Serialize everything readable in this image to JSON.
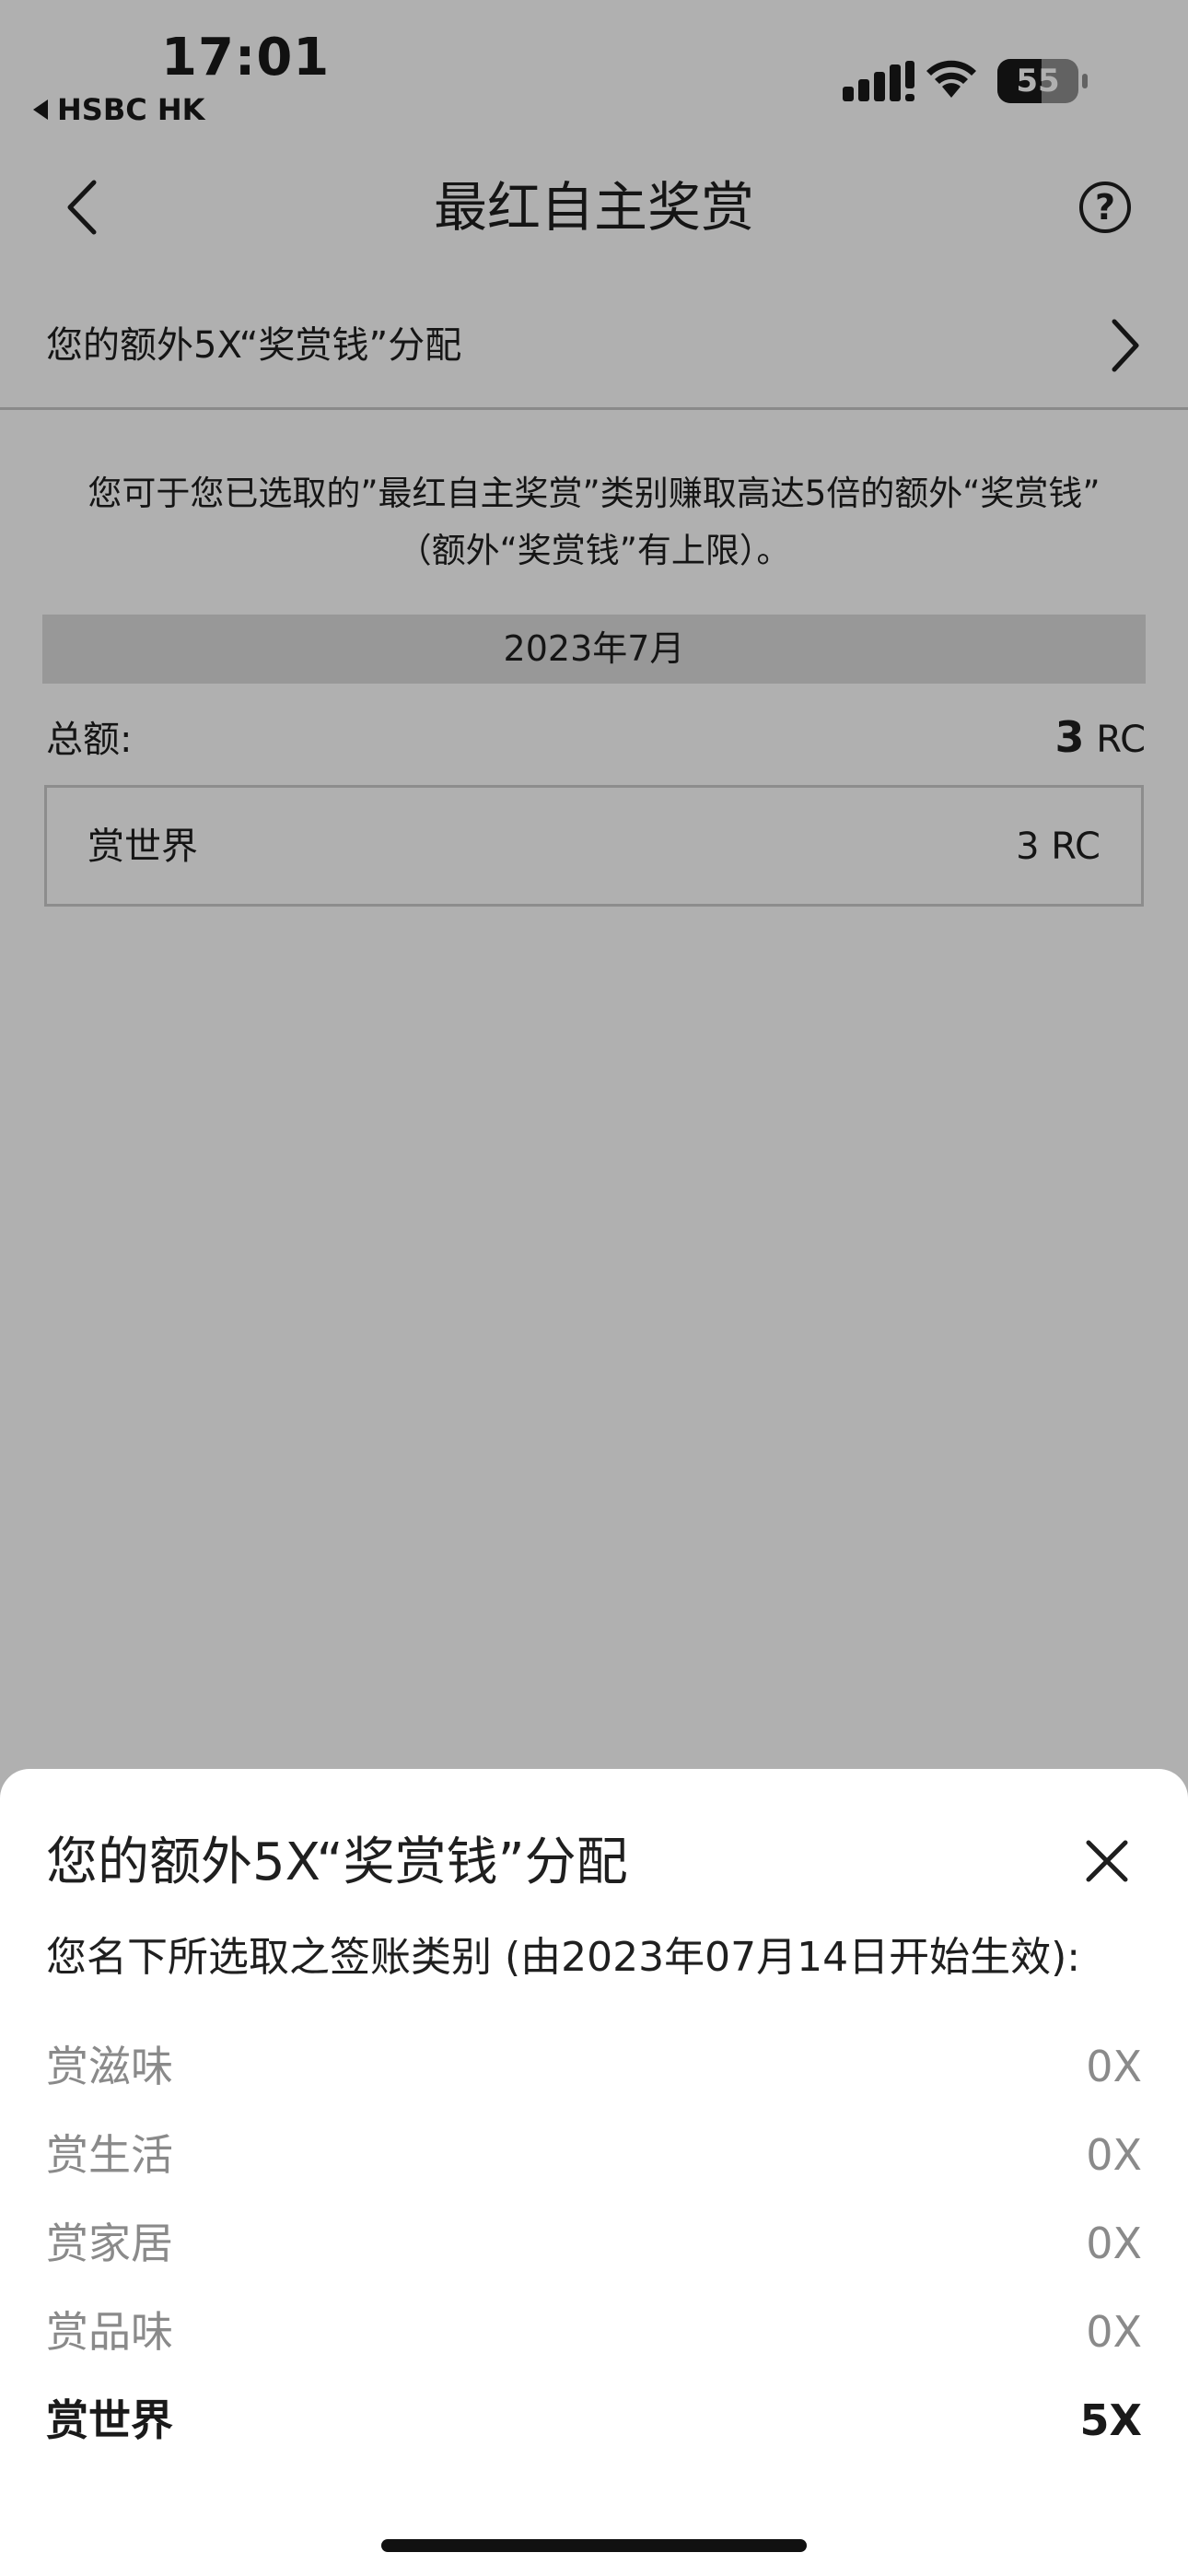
{
  "status_bar": {
    "time": "17:01",
    "back_app": "HSBC HK",
    "battery": "55",
    "battery_level": 0.55
  },
  "nav": {
    "title": "最红自主奖赏",
    "help_symbol": "?"
  },
  "allocation_row": {
    "label": "您的额外5X“奖赏钱”分配"
  },
  "intro": {
    "line1": "您可于您已选取的”最红自主奖赏”类别赚取高达5倍的额外“奖赏钱”",
    "line2": "（额外“奖赏钱”有上限）。"
  },
  "summary": {
    "month": "2023年7月",
    "total_label": "总额:",
    "total_value": "3",
    "total_unit": "RC",
    "category": {
      "name": "赏世界",
      "value": "3 RC"
    }
  },
  "sheet": {
    "title": "您的额外5X“奖赏钱”分配",
    "subtitle": "您名下所选取之签账类别 (由2023年07月14日开始生效):",
    "items": [
      {
        "name": "赏滋味",
        "value": "0X"
      },
      {
        "name": "赏生活",
        "value": "0X"
      },
      {
        "name": "赏家居",
        "value": "0X"
      },
      {
        "name": "赏品味",
        "value": "0X"
      },
      {
        "name": "赏世界",
        "value": "5X"
      }
    ]
  },
  "icons": {
    "back": "chevron-left-icon",
    "help": "question-circle-icon",
    "row_chevron": "chevron-right-icon",
    "close": "close-icon",
    "back_app": "triangle-left-icon"
  }
}
